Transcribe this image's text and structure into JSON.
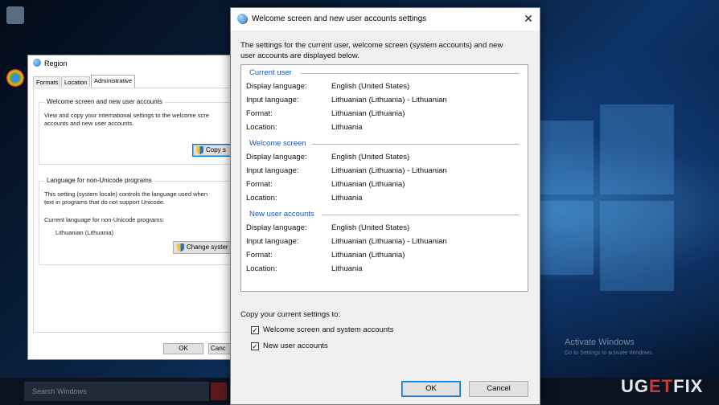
{
  "desktop": {
    "activate_windows": {
      "title": "Activate Windows",
      "subtitle": "Go to Settings to activate Windows."
    },
    "taskbar": {
      "search_placeholder": "Search Windows"
    },
    "watermark": {
      "left": "UG",
      "mid": "ET",
      "right": "FIX"
    }
  },
  "region_dialog": {
    "title": "Region",
    "tabs": [
      "Formats",
      "Location",
      "Administrative"
    ],
    "active_tab": "Administrative",
    "welcome_group": {
      "title": "Welcome screen and new user accounts",
      "description_line1": "View and copy your international settings to the welcome scre",
      "description_line2": "accounts and new user accounts.",
      "copy_button": "Copy s"
    },
    "unicode_group": {
      "title": "Language for non-Unicode programs",
      "description_line1": "This setting (system locale) controls the language used when",
      "description_line2": "text in programs that do not support Unicode.",
      "current_label": "Current language for non-Unicode programs:",
      "current_value": "Lithuanian (Lithuania)",
      "change_button": "Change syster"
    },
    "buttons": {
      "ok": "OK",
      "cancel": "Canc"
    }
  },
  "welcome_dialog": {
    "title": "Welcome screen and new user accounts settings",
    "intro_line1": "The settings for the current user, welcome screen (system accounts) and new",
    "intro_line2": "user accounts are displayed below.",
    "sections": [
      {
        "heading": "Current user",
        "rows": [
          {
            "label": "Display language:",
            "value": "English (United States)"
          },
          {
            "label": "Input language:",
            "value": "Lithuanian (Lithuania) - Lithuanian"
          },
          {
            "label": "Format:",
            "value": "Lithuanian (Lithuania)"
          },
          {
            "label": "Location:",
            "value": "Lithuania"
          }
        ]
      },
      {
        "heading": "Welcome screen",
        "rows": [
          {
            "label": "Display language:",
            "value": "English (United States)"
          },
          {
            "label": "Input language:",
            "value": "Lithuanian (Lithuania) - Lithuanian"
          },
          {
            "label": "Format:",
            "value": "Lithuanian (Lithuania)"
          },
          {
            "label": "Location:",
            "value": "Lithuania"
          }
        ]
      },
      {
        "heading": "New user accounts",
        "rows": [
          {
            "label": "Display language:",
            "value": "English (United States)"
          },
          {
            "label": "Input language:",
            "value": "Lithuanian (Lithuania) - Lithuanian"
          },
          {
            "label": "Format:",
            "value": "Lithuanian (Lithuania)"
          },
          {
            "label": "Location:",
            "value": "Lithuania"
          }
        ]
      }
    ],
    "copy_label": "Copy your current settings to:",
    "checkboxes": [
      {
        "label": "Welcome screen and system accounts",
        "checked": true
      },
      {
        "label": "New user accounts",
        "checked": true
      }
    ],
    "buttons": {
      "ok": "OK",
      "cancel": "Cancel"
    }
  }
}
